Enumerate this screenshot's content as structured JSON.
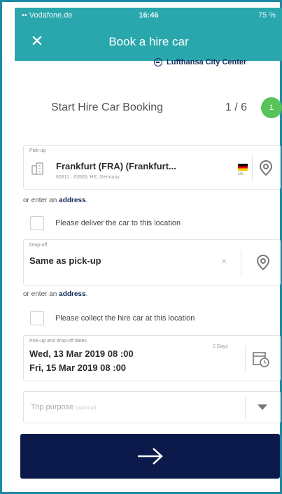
{
  "status_bar": {
    "carrier": "•• Vodafone.de",
    "time": "16:46",
    "battery": "75 %"
  },
  "navbar": {
    "close_icon": "close-icon",
    "title": "Book a hire car"
  },
  "brand": {
    "name": "Lufthansa City Center"
  },
  "step": {
    "title": "Start Hire Car Booking",
    "count": "1 / 6",
    "dot": "1"
  },
  "pickup": {
    "label": "Pick-up",
    "value": "Frankfurt (FRA) (Frankfurt...",
    "address": "60311 · 63505, HE, Germany",
    "country_code": "DE",
    "icons": {
      "type": "building-icon",
      "locate": "map-pin-icon"
    }
  },
  "pickup_address_link": {
    "prefix": "or enter an",
    "link": "address",
    "suffix": "."
  },
  "deliver_checkbox": {
    "label": "Please deliver the car to this location"
  },
  "dropoff": {
    "label": "Drop-off",
    "value": "Same as pick-up",
    "clear": "×",
    "icons": {
      "locate": "map-pin-icon"
    }
  },
  "dropoff_address_link": {
    "prefix": "or enter an",
    "link": "address",
    "suffix": "."
  },
  "collect_checkbox": {
    "label": "Please collect the hire car at this location"
  },
  "dates": {
    "label": "Pick-up and drop-off dates",
    "pickup": "Wed, 13 Mar 2019  08 :00",
    "dropoff": "Fri, 15 Mar 2019  08 :00",
    "duration": "2 Days",
    "icons": {
      "calendar": "calendar-clock-icon"
    }
  },
  "trip_purpose": {
    "placeholder": "Trip purpose",
    "optional": "(optional)",
    "icons": {
      "dropdown": "chevron-down-icon"
    }
  },
  "submit": {
    "icon": "arrow-right-icon"
  },
  "colors": {
    "header": "#2aa7ad",
    "accent": "#102a5c",
    "button": "#0b1a4a",
    "step_dot": "#57c45a",
    "frame": "#1e8aa6"
  }
}
